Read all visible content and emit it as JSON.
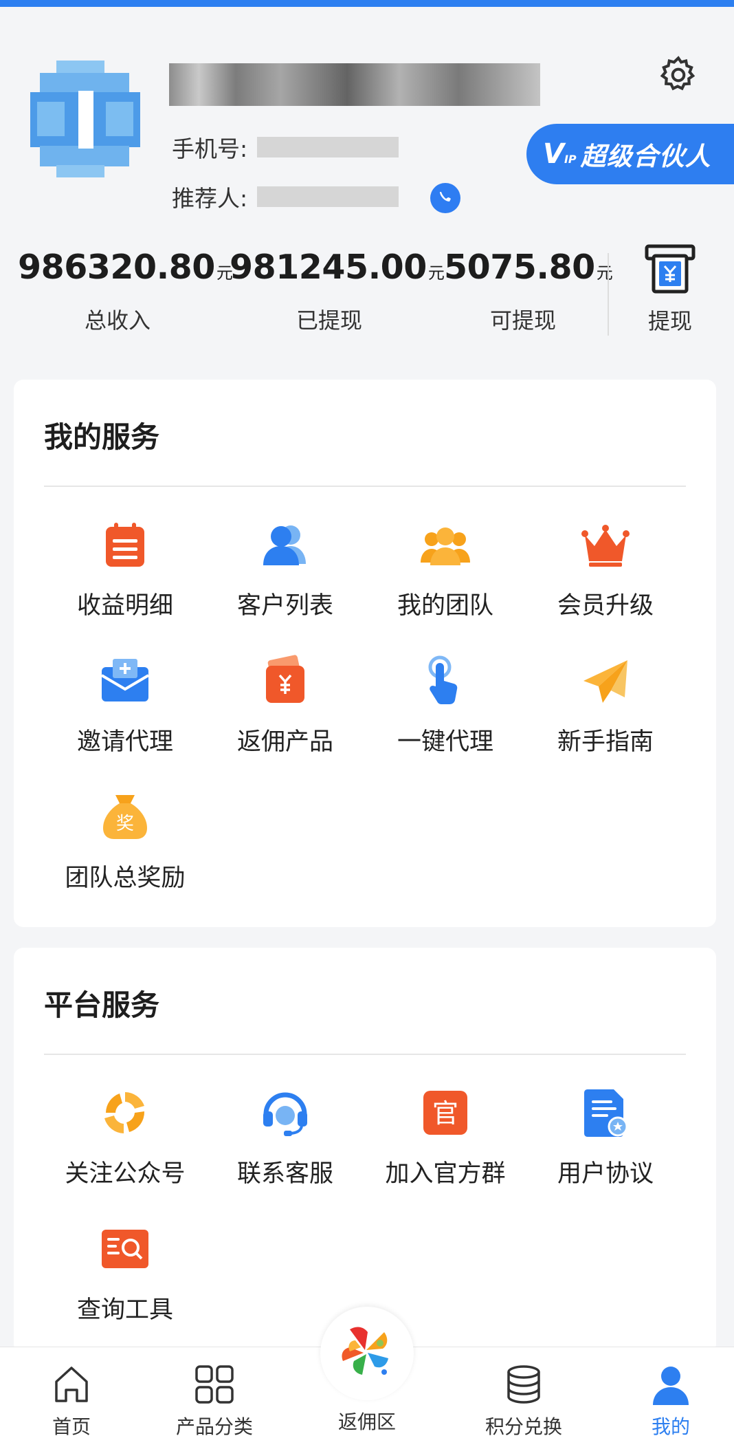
{
  "profile": {
    "phone_label": "手机号:",
    "referrer_label": "推荐人:",
    "vip_prefix": "V",
    "vip_sub": "IP",
    "vip_title": "超级合伙人"
  },
  "stats": {
    "total_income": {
      "value": "986320.80",
      "unit": "元",
      "label": "总收入"
    },
    "withdrawn": {
      "value": "981245.00",
      "unit": "元",
      "label": "已提现"
    },
    "available": {
      "value": "5075.80",
      "unit": "元",
      "label": "可提现"
    },
    "withdraw_button": "提现"
  },
  "my_services": {
    "title": "我的服务",
    "items": [
      {
        "label": "收益明细",
        "icon": "ledger-icon"
      },
      {
        "label": "客户列表",
        "icon": "customers-icon"
      },
      {
        "label": "我的团队",
        "icon": "team-icon"
      },
      {
        "label": "会员升级",
        "icon": "crown-icon"
      },
      {
        "label": "邀请代理",
        "icon": "envelope-icon"
      },
      {
        "label": "返佣产品",
        "icon": "wallet-yuan-icon"
      },
      {
        "label": "一键代理",
        "icon": "tap-hand-icon"
      },
      {
        "label": "新手指南",
        "icon": "paper-plane-icon"
      },
      {
        "label": "团队总奖励",
        "icon": "money-bag-icon",
        "glyph": "奖"
      }
    ]
  },
  "platform_services": {
    "title": "平台服务",
    "items": [
      {
        "label": "关注公众号",
        "icon": "loop-icon"
      },
      {
        "label": "联系客服",
        "icon": "headset-icon"
      },
      {
        "label": "加入官方群",
        "icon": "official-group-icon",
        "glyph": "官"
      },
      {
        "label": "用户协议",
        "icon": "document-icon"
      },
      {
        "label": "查询工具",
        "icon": "search-book-icon"
      }
    ]
  },
  "bottom_nav": {
    "items": [
      {
        "label": "首页",
        "icon": "home-icon"
      },
      {
        "label": "产品分类",
        "icon": "grid-icon"
      },
      {
        "label": "返佣区",
        "icon": "rebate-logo-icon"
      },
      {
        "label": "积分兑换",
        "icon": "coins-stack-icon"
      },
      {
        "label": "我的",
        "icon": "user-icon",
        "active": true
      }
    ]
  },
  "colors": {
    "primary": "#2d7ff0",
    "orange_red": "#f05a28",
    "amber": "#f8a31a"
  }
}
